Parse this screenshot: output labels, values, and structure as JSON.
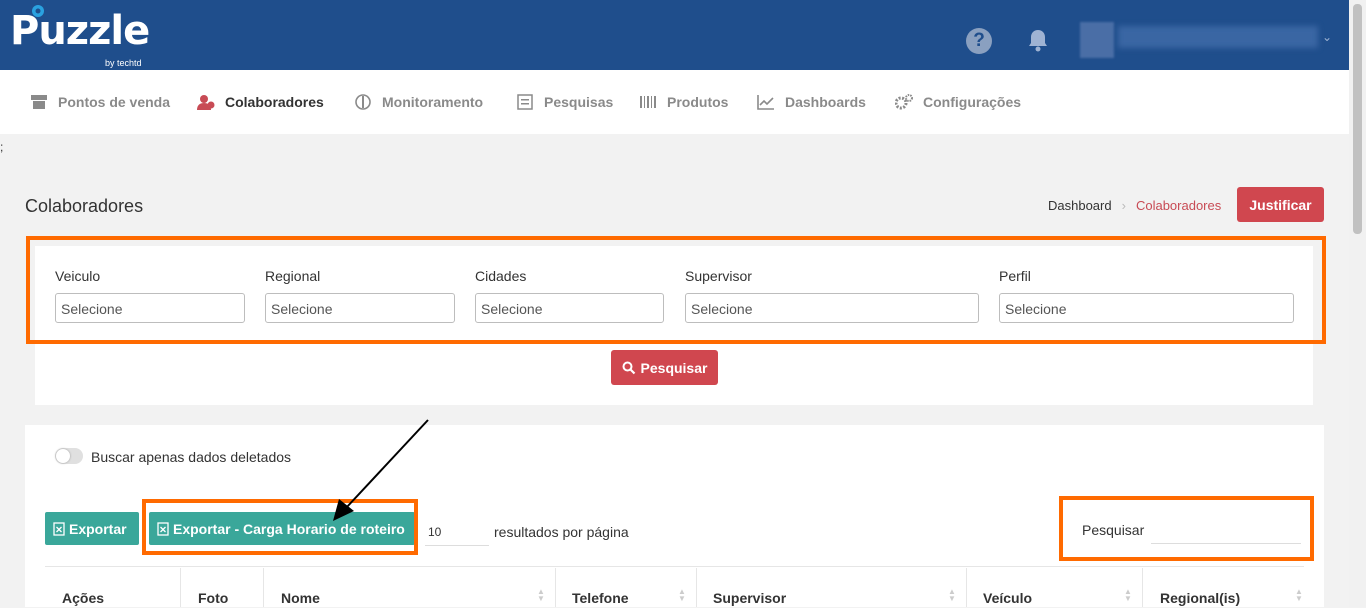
{
  "header": {
    "logo_text": "Puzzle",
    "logo_sub": "by techtd",
    "help_icon": "?",
    "caret": "⌄"
  },
  "nav": [
    {
      "label": "Pontos de venda",
      "icon": "store-icon"
    },
    {
      "label": "Colaboradores",
      "icon": "users-icon",
      "active": true
    },
    {
      "label": "Monitoramento",
      "icon": "monitor-icon"
    },
    {
      "label": "Pesquisas",
      "icon": "survey-icon"
    },
    {
      "label": "Produtos",
      "icon": "barcode-icon"
    },
    {
      "label": "Dashboards",
      "icon": "chart-icon"
    },
    {
      "label": "Configurações",
      "icon": "gears-icon"
    }
  ],
  "stray_char": ";",
  "page": {
    "title": "Colaboradores",
    "breadcrumb": [
      "Dashboard",
      "Colaboradores"
    ],
    "justify_button": "Justificar"
  },
  "filters": {
    "fields": [
      {
        "label": "Veiculo",
        "placeholder": "Selecione"
      },
      {
        "label": "Regional",
        "placeholder": "Selecione"
      },
      {
        "label": "Cidades",
        "placeholder": "Selecione"
      },
      {
        "label": "Supervisor",
        "placeholder": "Selecione"
      },
      {
        "label": "Perfil",
        "placeholder": "Selecione"
      }
    ],
    "search_button": "Pesquisar"
  },
  "table": {
    "toggle_label": "Buscar apenas dados deletados",
    "export_button": "Exportar",
    "export_schedule_button": "Exportar - Carga Horario de roteiro",
    "per_page_value": "10",
    "per_page_label": "resultados por página",
    "search_label": "Pesquisar",
    "columns": [
      "Ações",
      "Foto",
      "Nome",
      "Telefone",
      "Supervisor",
      "Veículo",
      "Regional(is)"
    ]
  },
  "colors": {
    "header_bg": "#1f4e8c",
    "accent_red": "#d0474f",
    "export_teal": "#3aa79a",
    "highlight_orange": "#ff6a00"
  }
}
